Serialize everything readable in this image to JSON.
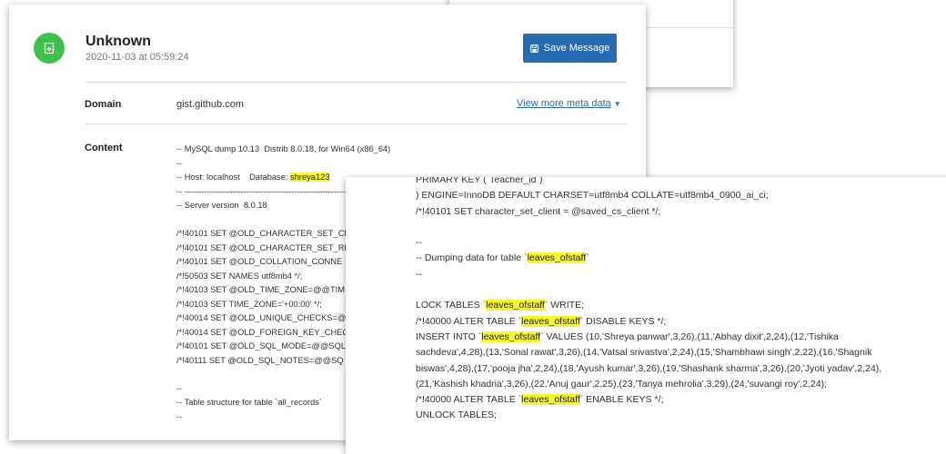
{
  "message": {
    "title": "Unknown",
    "timestamp": "2020-11-03 at 05:59:24",
    "save_label": "Save Message",
    "domain_label": "Domain",
    "domain_value": "gist.github.com",
    "meta_link": "View more meta data",
    "content_label": "Content"
  },
  "content_lines": [
    {
      "text": "-- MySQL dump 10.13  Distrib 8.0.18, for Win64 (x86_64)"
    },
    {
      "text": "--"
    },
    {
      "text": "-- Host: localhost    Database: ",
      "hl": "shreya123"
    },
    {
      "text": "-- -----------------------------------------------------------"
    },
    {
      "text": "-- Server version  8.0.18"
    },
    {
      "text": ""
    },
    {
      "text": "/*!40101 SET @OLD_CHARACTER_SET_CL"
    },
    {
      "text": "/*!40101 SET @OLD_CHARACTER_SET_RE"
    },
    {
      "text": "/*!40101 SET @OLD_COLLATION_CONNE"
    },
    {
      "text": "/*!50503 SET NAMES utf8mb4 */;"
    },
    {
      "text": "/*!40103 SET @OLD_TIME_ZONE=@@TIM"
    },
    {
      "text": "/*!40103 SET TIME_ZONE='+00:00' */;"
    },
    {
      "text": "/*!40014 SET @OLD_UNIQUE_CHECKS=@"
    },
    {
      "text": "/*!40014 SET @OLD_FOREIGN_KEY_CHEC"
    },
    {
      "text": "/*!40101 SET @OLD_SQL_MODE=@@SQL"
    },
    {
      "text": "/*!40111 SET @OLD_SQL_NOTES=@@SQ"
    },
    {
      "text": ""
    },
    {
      "text": "--"
    },
    {
      "text": "-- Table structure for table `all_records`"
    },
    {
      "text": "--"
    }
  ],
  "front": {
    "l1": "PRIMARY KEY (`Teacher_id`)",
    "l2": ") ENGINE=InnoDB DEFAULT CHARSET=utf8mb4 COLLATE=utf8mb4_0900_ai_ci;",
    "l3": "/*!40101 SET character_set_client = @saved_cs_client */;",
    "l4": "--",
    "l5_pre": "-- Dumping data for table `",
    "l5_post": "`",
    "l6": "--",
    "l7_pre": "LOCK TABLES `",
    "l7_post": "` WRITE;",
    "l8_pre": "/*!40000 ALTER TABLE `",
    "l8_post": "` DISABLE KEYS */;",
    "l9_pre": "INSERT INTO `",
    "l9_post": "` VALUES (10,'Shreya panwar',3,26),(11,'Abhay dixit',2,24),(12,'Tishika",
    "l10": "sachdeva',4,28),(13,'Sonal rawat',3,26),(14,'Vatsal srivastva',2,24),(15,'Shambhawi singh',2,22),(16,'Shagnik",
    "l11": "biswas',4,28),(17,'pooja jha',2,24),(18,'Ayush kumar',3,26),(19,'Shashank sharma',3,26),(20,'Jyoti yadav',2,24),",
    "l12": "(21,'Kashish khadria',3,26),(22,'Anuj gaur',2,25),(23,'Tanya mehrolia',3,29),(24,'suvangi roy',2,24);",
    "l13_pre": "/*!40000 ALTER TABLE `",
    "l13_post": "` ENABLE KEYS */;",
    "l14": "UNLOCK TABLES;",
    "table_name": "leaves_ofstaff"
  },
  "colors": {
    "accent": "#2a6ab0",
    "avatar": "#3cc14a",
    "highlight": "#f7f72c"
  },
  "icons": {
    "avatar": "document-icon",
    "save": "floppy-disk-icon",
    "caret": "caret-down-icon"
  }
}
